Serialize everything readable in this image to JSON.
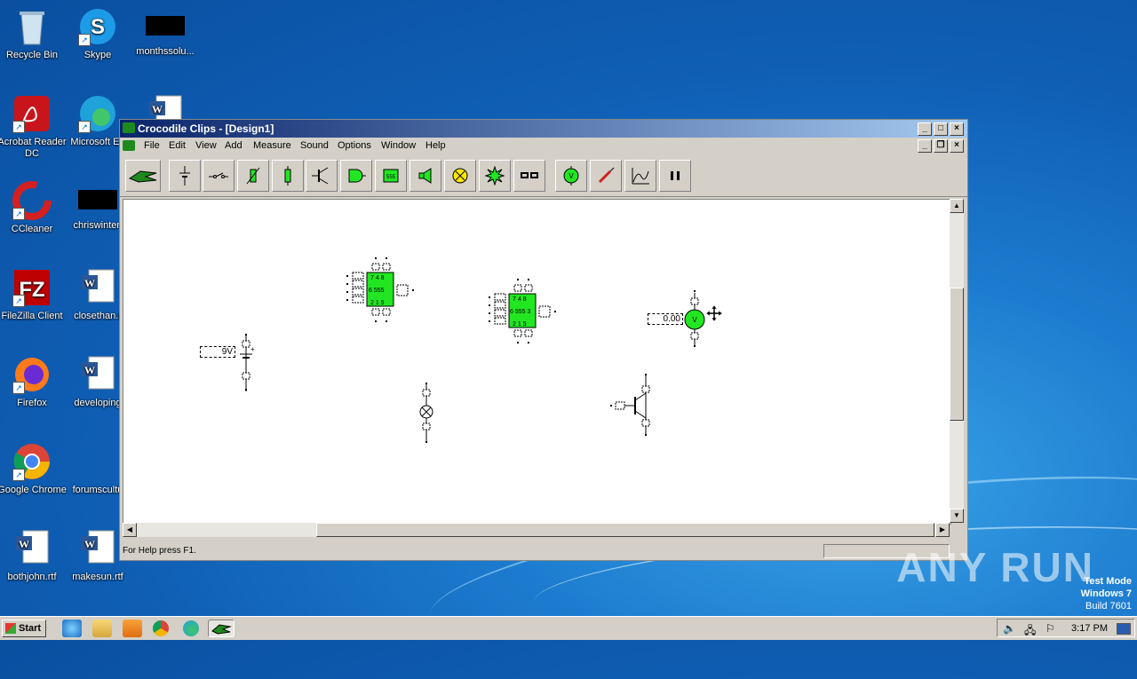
{
  "desktop": {
    "icons": [
      {
        "label": "Recycle Bin"
      },
      {
        "label": "Skype"
      },
      {
        "label": "monthssolu..."
      },
      {
        "label": "Acrobat Reader DC"
      },
      {
        "label": "Microsoft Ed"
      },
      {
        "label": ""
      },
      {
        "label": "CCleaner"
      },
      {
        "label": "chriswinter."
      },
      {
        "label": "FileZilla Client"
      },
      {
        "label": "closethan.r"
      },
      {
        "label": "Firefox"
      },
      {
        "label": "developing"
      },
      {
        "label": "Google Chrome"
      },
      {
        "label": "forumscultu"
      },
      {
        "label": "bothjohn.rtf"
      },
      {
        "label": "makesun.rtf"
      }
    ]
  },
  "window": {
    "title": "Crocodile Clips - [Design1]",
    "menu": [
      "File",
      "Edit",
      "View",
      "Add",
      "Measure",
      "Sound",
      "Options",
      "Window",
      "Help"
    ],
    "toolbar": [
      "crocodile-logo",
      "battery",
      "switch",
      "variable-resistor",
      "resistor",
      "transistor",
      "logic-gate",
      "555-chip",
      "speaker",
      "lamp",
      "burst",
      "connector",
      "voltmeter",
      "probe",
      "graph",
      "pause"
    ],
    "chip_label": "555",
    "status": "For Help press F1."
  },
  "circuit": {
    "battery_value": "9V",
    "voltmeter_value": "0.00",
    "voltmeter_symbol": "V",
    "chip1": {
      "pins_top": "7  4   8",
      "center": "6  555",
      "pins_bottom": "2  1   5"
    },
    "chip2": {
      "pins_top": "7  4   8",
      "center": "6  555  3",
      "pins_bottom": "2  1   5"
    }
  },
  "taskbar": {
    "start_label": "Start",
    "clock": "3:17 PM"
  },
  "overlay": {
    "watermark": "ANY RUN",
    "testmode_title": "Test Mode",
    "testmode_os": "Windows 7",
    "testmode_build": "Build 7601"
  }
}
